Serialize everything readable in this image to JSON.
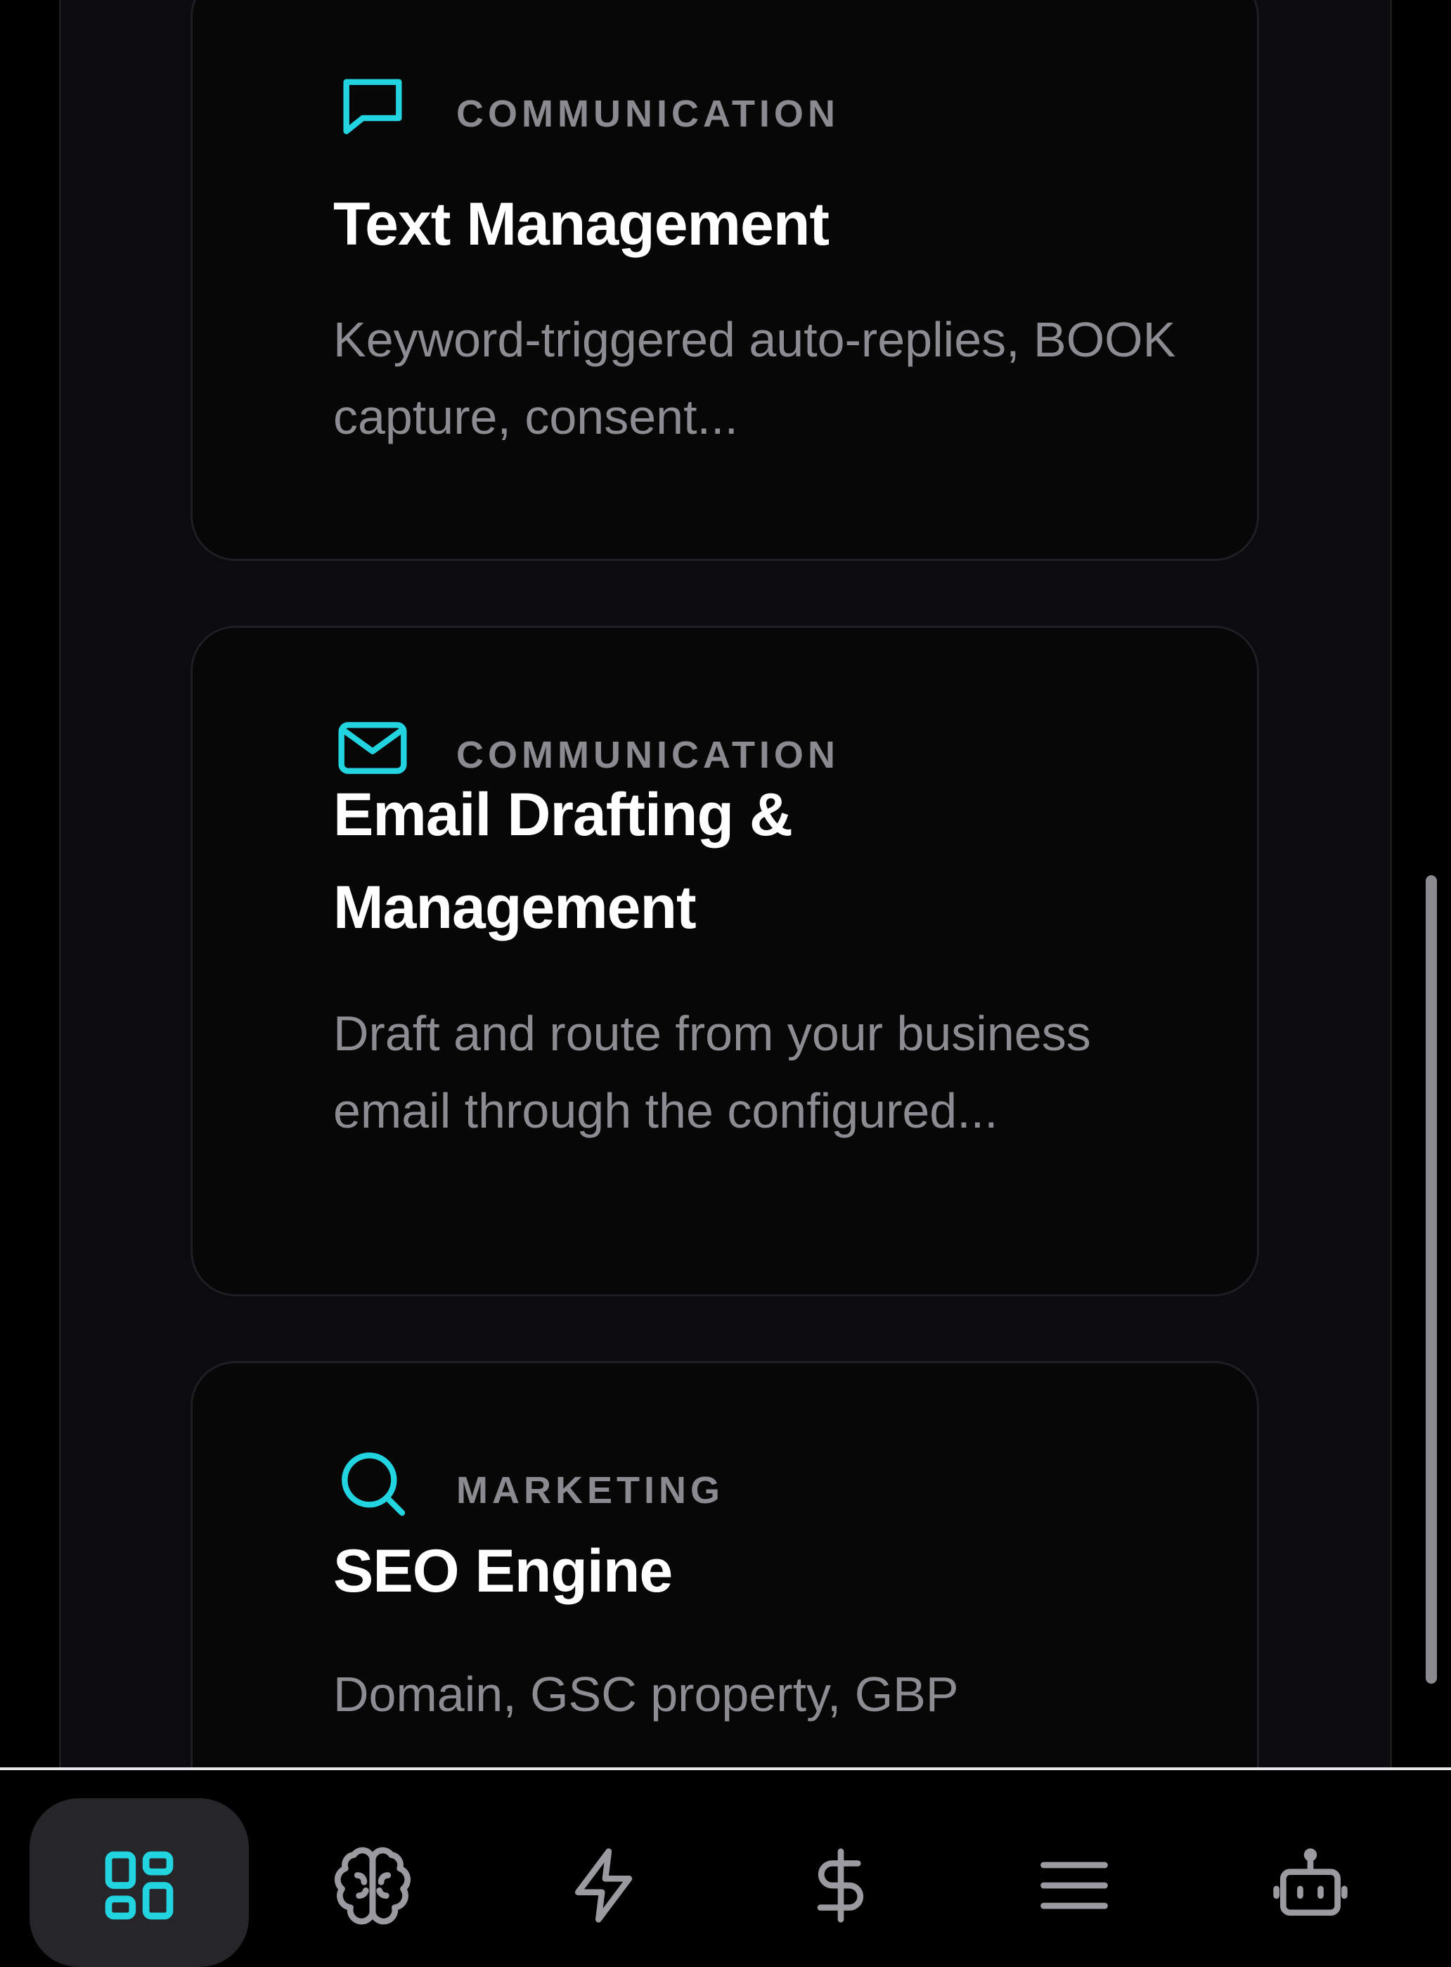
{
  "cards": [
    {
      "category": "COMMUNICATION",
      "icon": "message-square-icon",
      "title": "Text Management",
      "description": "Keyword-triggered auto-replies, BOOK capture, consent..."
    },
    {
      "category": "COMMUNICATION",
      "icon": "mail-icon",
      "title": "Email Drafting & Management",
      "description": "Draft and route from your business email through the configured..."
    },
    {
      "category": "MARKETING",
      "icon": "search-icon",
      "title": "SEO Engine",
      "description": "Domain, GSC property, GBP"
    }
  ],
  "tabbar": {
    "active_index": 0,
    "tabs": [
      {
        "icon": "dashboard-grid-icon"
      },
      {
        "icon": "brain-icon"
      },
      {
        "icon": "lightning-bolt-icon"
      },
      {
        "icon": "dollar-sign-icon"
      },
      {
        "icon": "menu-icon"
      },
      {
        "icon": "bot-icon"
      }
    ]
  },
  "colors": {
    "accent": "#22d3e0",
    "background": "#000000",
    "panel": "#0c0c0e",
    "card": "#070708",
    "title_text": "#ffffff",
    "muted_text": "#8c8c92",
    "inactive_icon": "#9a9aa0"
  }
}
